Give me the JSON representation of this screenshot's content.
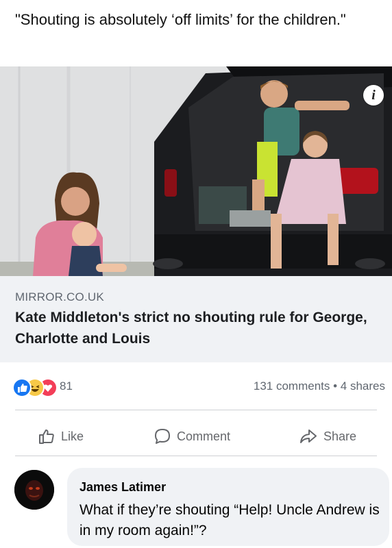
{
  "post": {
    "text": "\"Shouting is absolutely ‘off limits’ for the children.\""
  },
  "link": {
    "domain": "MIRROR.CO.UK",
    "title": "Kate Middleton's strict no shouting rule for George, Charlotte and Louis",
    "info_icon": "i"
  },
  "stats": {
    "reaction_icons": [
      "like-icon",
      "haha-icon",
      "love-icon"
    ],
    "reaction_count": "81",
    "comments_shares": "131 comments • 4 shares"
  },
  "actions": {
    "like": "Like",
    "comment": "Comment",
    "share": "Share"
  },
  "comment": {
    "author": "James Latimer",
    "text": "What if they’re shouting “Help! Uncle Andrew is in my room again!”?"
  },
  "colors": {
    "link_background": "#f0f2f5",
    "meta_text": "#606770",
    "like_blue": "#1877f2",
    "love_red": "#f33e58",
    "haha_yellow": "#f7c948"
  }
}
